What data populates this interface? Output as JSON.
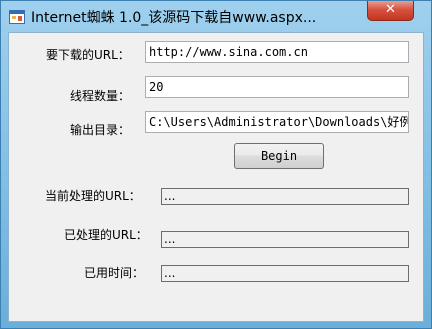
{
  "window": {
    "title": "Internet蜘蛛 1.0_该源码下载自www.aspx...",
    "close_glyph": "✕"
  },
  "form": {
    "url_label": "要下载的URL：",
    "url_value": "http://www.sina.com.cn",
    "threads_label": "线程数量：",
    "threads_value": "20",
    "output_label": "输出目录：",
    "output_value": "C:\\Users\\Administrator\\Downloads\\好例",
    "begin_label": "Begin"
  },
  "status": {
    "current_url_label": "当前处理的URL：",
    "current_url_value": "...",
    "processed_url_label": "已处理的URL：",
    "processed_url_value": "...",
    "elapsed_label": "已用时间：",
    "elapsed_value": "..."
  },
  "colors": {
    "title_bar": "#7ebde4",
    "close_button": "#c7402b",
    "client_background": "#f0f0f0"
  },
  "icons": {
    "app": "window-app-icon",
    "close": "close-icon"
  }
}
